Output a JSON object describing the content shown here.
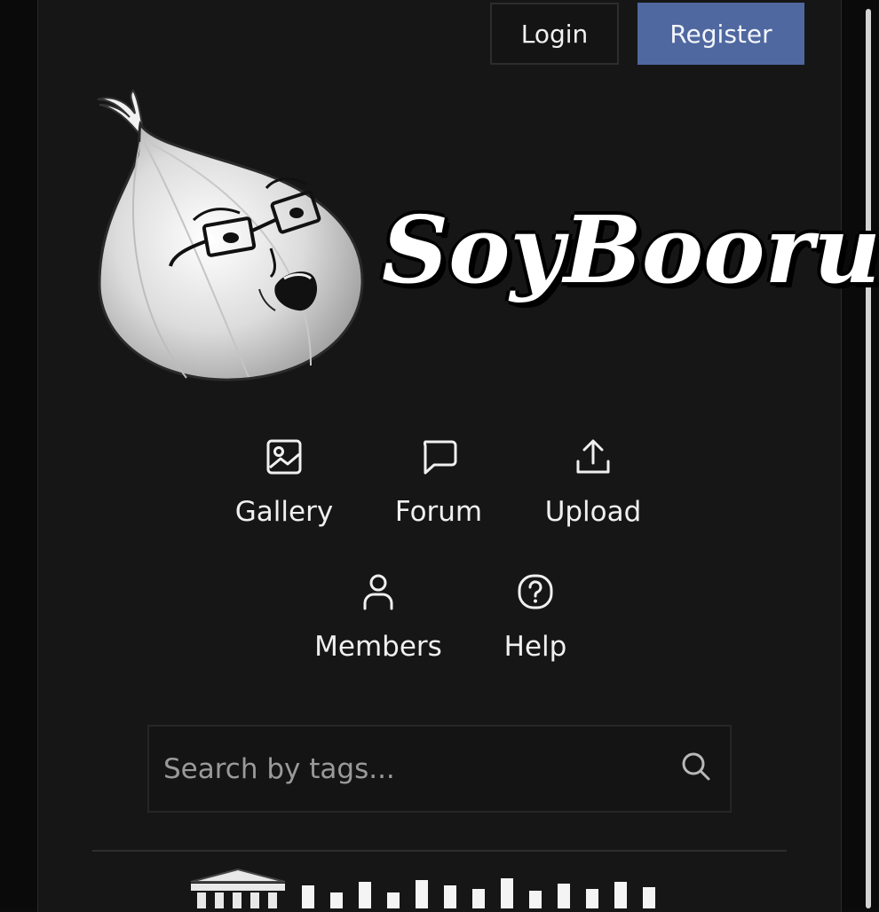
{
  "header": {
    "login_label": "Login",
    "register_label": "Register"
  },
  "logo": {
    "text": "SoyBooru"
  },
  "nav": {
    "gallery": "Gallery",
    "forum": "Forum",
    "upload": "Upload",
    "members": "Members",
    "help": "Help"
  },
  "search": {
    "placeholder": "Search by tags..."
  },
  "icons": [
    "image-icon",
    "chat-icon",
    "upload-icon",
    "person-icon",
    "help-circle-icon",
    "search-icon"
  ],
  "colors": {
    "background": "#161616",
    "register_button": "#4f68a0",
    "text": "#f0f0f0"
  }
}
